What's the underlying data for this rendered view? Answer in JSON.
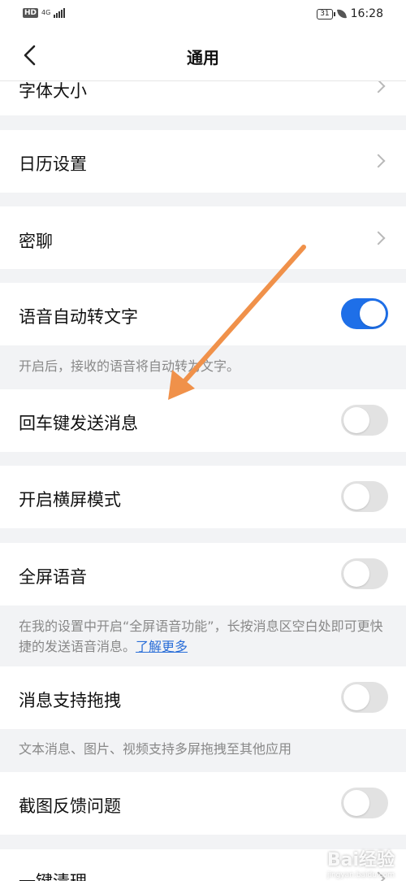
{
  "status_bar": {
    "hd": "HD",
    "network": "4G",
    "battery": "31",
    "time": "16:28"
  },
  "nav": {
    "title": "通用",
    "back_icon": "chevron-left-icon"
  },
  "rows": {
    "font_size": "字体大小",
    "calendar": "日历设置",
    "secret_chat": "密聊",
    "voice_to_text": "语音自动转文字",
    "voice_to_text_hint": "开启后，接收的语音将自动转为文字。",
    "enter_send": "回车键发送消息",
    "landscape": "开启横屏模式",
    "fullscreen_voice": "全屏语音",
    "fullscreen_voice_hint": "在我的设置中开启“全屏语音功能”，长按消息区空白处即可更快捷的发送语音消息。",
    "learn_more": "了解更多",
    "drag": "消息支持拖拽",
    "drag_hint": "文本消息、图片、视频支持多屏拖拽至其他应用",
    "screenshot_feedback": "截图反馈问题",
    "one_click_clean": "一键清理"
  },
  "toggles": {
    "voice_to_text": true,
    "enter_send": false,
    "landscape": false,
    "fullscreen_voice": false,
    "drag": false,
    "screenshot_feedback": false
  },
  "colors": {
    "accent": "#1e6fe8",
    "arrow": "#f0914a",
    "background": "#f2f3f5"
  },
  "watermark": {
    "text": "Bai经验",
    "sub": "jingyan.baidu.com"
  }
}
